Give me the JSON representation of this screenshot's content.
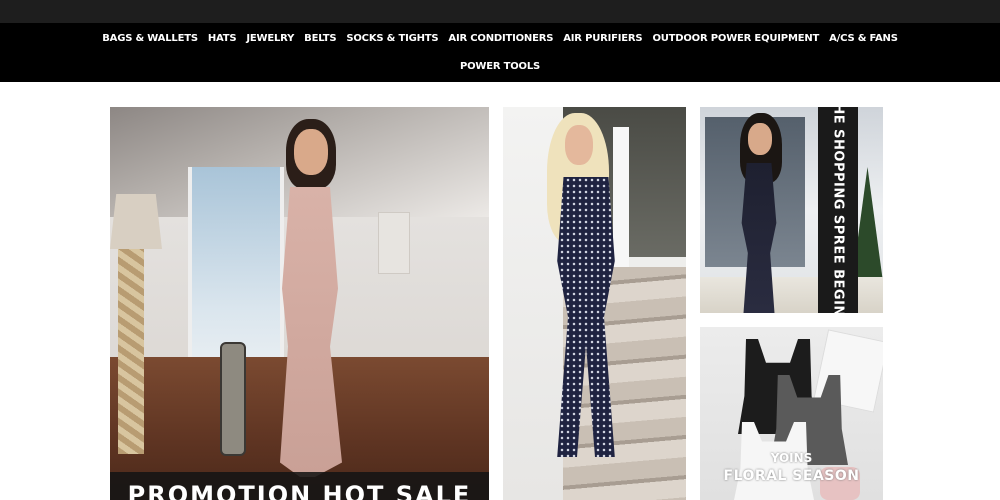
{
  "nav": {
    "items": [
      {
        "label": "BAGS & WALLETS"
      },
      {
        "label": "HATS"
      },
      {
        "label": "JEWELRY"
      },
      {
        "label": "BELTS"
      },
      {
        "label": "SOCKS & TIGHTS"
      },
      {
        "label": "AIR CONDITIONERS"
      },
      {
        "label": "AIR PURIFIERS"
      },
      {
        "label": "OUTDOOR POWER EQUIPMENT"
      },
      {
        "label": "A/CS & FANS"
      }
    ],
    "row2": [
      {
        "label": "POWER TOOLS"
      }
    ]
  },
  "promo": {
    "banner_text": "PROMOTION HOT SALE"
  },
  "spree": {
    "vertical_text": "THE SHOPPING SPREE BEGINS"
  },
  "floral": {
    "brand": "YOINS",
    "caption": "FLORAL SEASON"
  },
  "colors": {
    "nav_bg": "#000000",
    "topbar_bg": "#1e1e1e",
    "nav_text": "#ffffff"
  }
}
